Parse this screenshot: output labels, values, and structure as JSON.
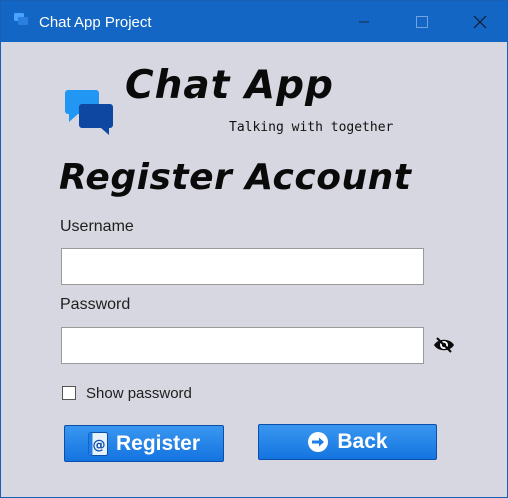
{
  "window": {
    "title": "Chat App Project"
  },
  "header": {
    "brand": "Chat App",
    "tagline": "Talking with together"
  },
  "form": {
    "heading": "Register Account",
    "username": {
      "label": "Username",
      "value": ""
    },
    "password": {
      "label": "Password",
      "value": ""
    },
    "show_password": {
      "label": "Show password",
      "checked": false
    }
  },
  "buttons": {
    "register": "Register",
    "back": "Back"
  },
  "colors": {
    "titlebar": "#1366c4",
    "background": "#d6d7e0",
    "button": "#1f7de6",
    "logo_light": "#2196f3",
    "logo_dark": "#0d47a1"
  },
  "icons": {
    "app": "chat-bubbles-icon",
    "minimize": "minimize-icon",
    "maximize": "maximize-icon",
    "close": "close-icon",
    "logo": "chat-bubbles-icon",
    "toggle_password": "eye-slash-icon",
    "register": "at-sign-icon",
    "back": "arrow-right-icon"
  }
}
